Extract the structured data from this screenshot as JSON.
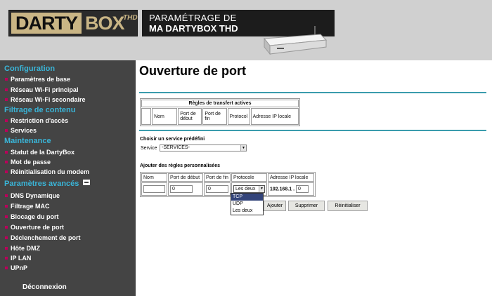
{
  "header": {
    "logo_part1": "DARTY",
    "logo_part2": "BOX",
    "logo_thd": "THD",
    "tagline_line1": "PARAMÉTRAGE DE",
    "tagline_line2": "MA DARTYBOX THD"
  },
  "sidebar": {
    "sections": [
      {
        "title": "Configuration",
        "items": [
          "Paramètres de base",
          "Réseau Wi-Fi principal",
          "Réseau Wi-Fi secondaire"
        ]
      },
      {
        "title": "Filtrage de contenu",
        "items": [
          "Restriction d'accès",
          "Services"
        ]
      },
      {
        "title": "Maintenance",
        "items": [
          "Statut de la DartyBox",
          "Mot de passe",
          "Réinitialisation du modem"
        ]
      },
      {
        "title": "Paramètres avancés",
        "items": [
          "DNS Dynamique",
          "Filtrage MAC",
          "Blocage du port",
          "Ouverture de port",
          "Déclenchement de port",
          "Hôte DMZ",
          "IP LAN",
          "UPnP"
        ]
      }
    ],
    "logout": "Déconnexion"
  },
  "main": {
    "title": "Ouverture de port",
    "active_rules": {
      "caption": "Règles de transfert actives",
      "headers": [
        "",
        "Nom",
        "Port de début",
        "Port de fin",
        "Protocol",
        "Adresse IP locale"
      ]
    },
    "predefined": {
      "heading": "Choisir un service prédéfini",
      "label": "Service",
      "value": "-SERVICES-"
    },
    "custom": {
      "heading": "Ajouter des règles personnalisées",
      "headers": [
        "Nom",
        "Port de début",
        "Port de fin",
        "Protocole",
        "Adresse IP locale"
      ],
      "row": {
        "name": "",
        "port_start": "0",
        "port_end": "0",
        "protocol": "Les deux",
        "ip_prefix": "192.168.1 .",
        "ip_last": "0"
      }
    },
    "protocol_options": [
      "TCP",
      "UDP",
      "Les deux"
    ],
    "protocol_highlight": "TCP",
    "buttons": {
      "add": "Ajouter",
      "remove": "Supprimer",
      "reset": "Réinitialiser"
    }
  },
  "colors": {
    "sidebar_bg": "#444444",
    "section_title": "#3ab5d8",
    "bullet": "#b8005a",
    "rule": "#3a9cad",
    "header_bg": "#d0d0d0"
  }
}
